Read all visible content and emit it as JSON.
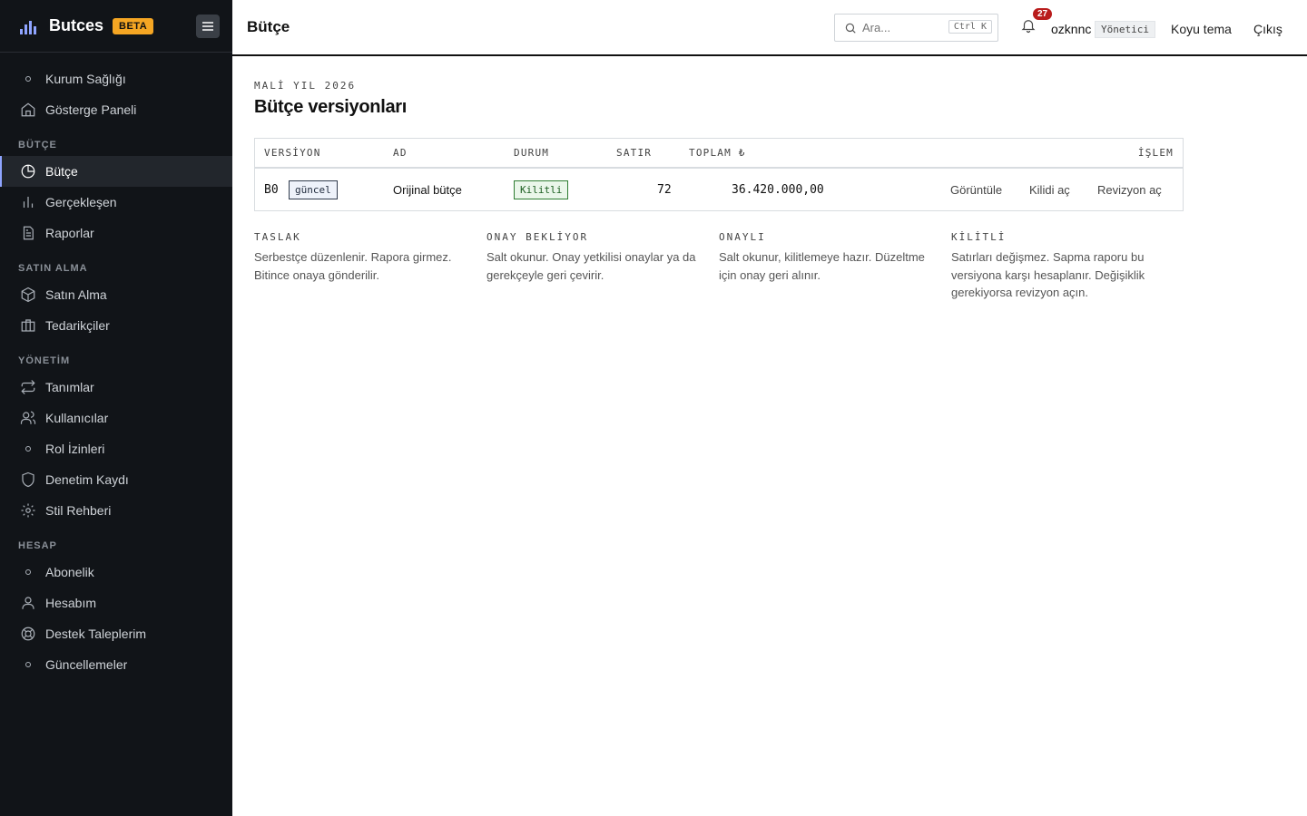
{
  "brand": {
    "name": "Butces",
    "badge": "BETA"
  },
  "sidebar": {
    "items": [
      {
        "label": "Kurum Sağlığı",
        "icon": "dot-icon"
      },
      {
        "label": "Gösterge Paneli",
        "icon": "home-icon"
      }
    ],
    "sections": [
      {
        "title": "BÜTÇE",
        "items": [
          {
            "label": "Bütçe",
            "icon": "pie-chart-icon",
            "active": true
          },
          {
            "label": "Gerçekleşen",
            "icon": "bar-chart-icon"
          },
          {
            "label": "Raporlar",
            "icon": "document-icon"
          }
        ]
      },
      {
        "title": "SATIN ALMA",
        "items": [
          {
            "label": "Satın Alma",
            "icon": "box-icon"
          },
          {
            "label": "Tedarikçiler",
            "icon": "briefcase-icon"
          }
        ]
      },
      {
        "title": "YÖNETİM",
        "items": [
          {
            "label": "Tanımlar",
            "icon": "repeat-icon"
          },
          {
            "label": "Kullanıcılar",
            "icon": "users-icon"
          },
          {
            "label": "Rol İzinleri",
            "icon": "dot-icon"
          },
          {
            "label": "Denetim Kaydı",
            "icon": "shield-icon"
          },
          {
            "label": "Stil Rehberi",
            "icon": "gear-icon"
          }
        ]
      },
      {
        "title": "HESAP",
        "items": [
          {
            "label": "Abonelik",
            "icon": "dot-icon"
          },
          {
            "label": "Hesabım",
            "icon": "user-icon"
          },
          {
            "label": "Destek Taleplerim",
            "icon": "lifebuoy-icon"
          },
          {
            "label": "Güncellemeler",
            "icon": "dot-icon"
          }
        ]
      }
    ]
  },
  "header": {
    "title": "Bütçe",
    "search_placeholder": "Ara...",
    "search_shortcut": "Ctrl K",
    "notification_count": "27",
    "user": "ozknnc",
    "role": "Yönetici",
    "theme_link": "Koyu tema",
    "logout": "Çıkış"
  },
  "main": {
    "eyebrow": "MALİ YIL 2026",
    "title": "Bütçe versiyonları",
    "table": {
      "columns": [
        "VERSİYON",
        "AD",
        "DURUM",
        "SATIR",
        "TOPLAM ₺",
        "İŞLEM"
      ],
      "rows": [
        {
          "version": "B0",
          "tag": "güncel",
          "name": "Orijinal bütçe",
          "status": "Kilitli",
          "lines": "72",
          "total": "36.420.000,00",
          "actions": [
            "Görüntüle",
            "Kilidi aç",
            "Revizyon aç"
          ]
        }
      ]
    },
    "states": [
      {
        "title": "TASLAK",
        "desc": "Serbestçe düzenlenir. Rapora girmez. Bitince onaya gönderilir."
      },
      {
        "title": "ONAY BEKLİYOR",
        "desc": "Salt okunur. Onay yetkilisi onaylar ya da gerekçeyle geri çevirir."
      },
      {
        "title": "ONAYLI",
        "desc": "Salt okunur, kilitlemeye hazır. Düzeltme için onay geri alınır."
      },
      {
        "title": "KİLİTLİ",
        "desc": "Satırları değişmez. Sapma raporu bu versiyona karşı hesaplanır. Değişiklik gerekiyorsa revizyon açın."
      }
    ]
  },
  "colors": {
    "sidebar_bg": "#111418",
    "accent": "#8fa4ff",
    "beta": "#f5a623",
    "badge": "#b91c1c",
    "locked": "#2e7d32"
  }
}
